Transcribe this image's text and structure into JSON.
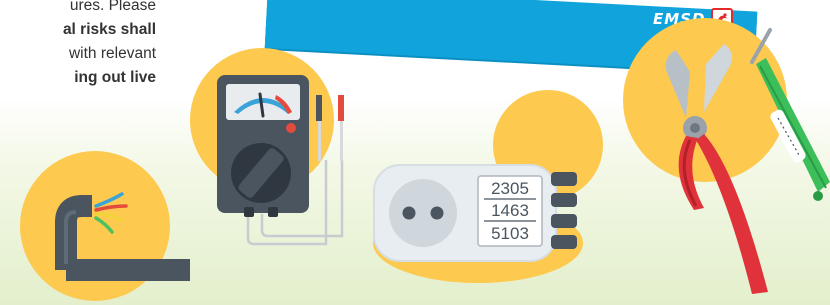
{
  "text": {
    "line1": "ures. Please",
    "line2": "al risks shall",
    "line3": "with relevant",
    "line4": "ing out live"
  },
  "banner": {
    "logo_text": "EMSD",
    "color": "#11a3dc"
  },
  "socket_tester": {
    "readings": [
      "2305",
      "1463",
      "5103"
    ]
  },
  "icons": [
    "cable-icon",
    "multimeter-icon",
    "socket-tester-icon",
    "pliers-icon",
    "voltage-tester-screwdriver-icon",
    "emsd-logo-icon"
  ],
  "colors": {
    "circle_yellow": "#fdc94f",
    "meter_body": "#4a5560",
    "plier_red": "#e0323a",
    "tester_green": "#3cbf5a"
  }
}
